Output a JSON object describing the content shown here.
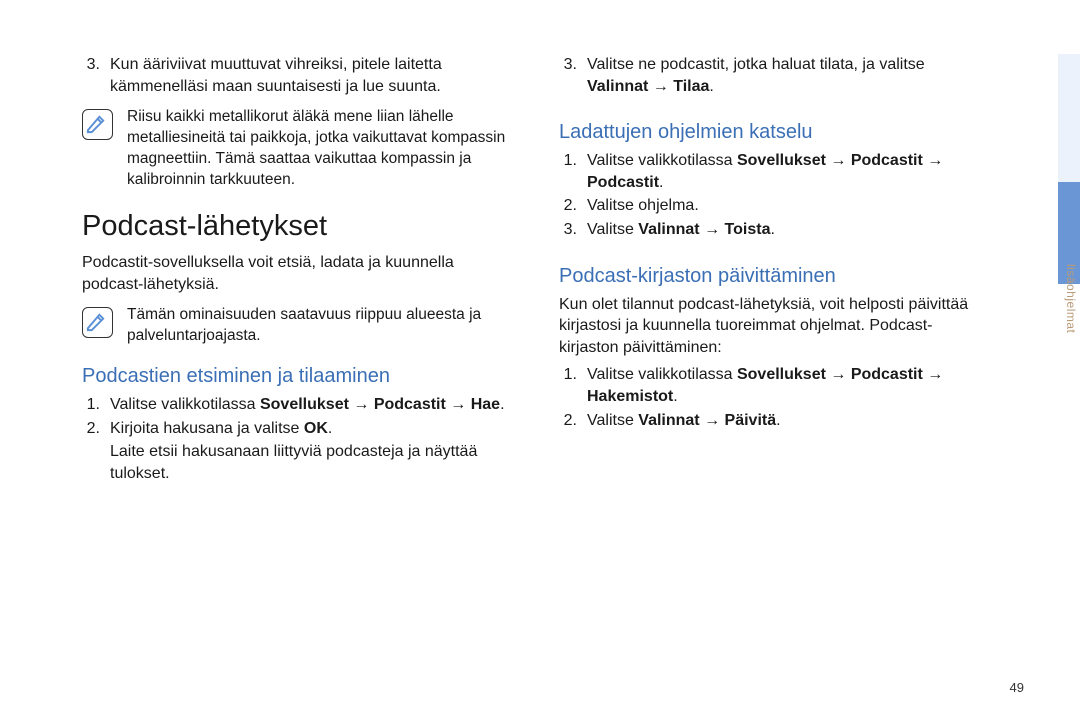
{
  "side_tab_label": "lisäohjelmat",
  "page_number": "49",
  "left": {
    "item3_num": "3.",
    "item3_text": "Kun ääriviivat muuttuvat vihreiksi, pitele laitetta kämmenelläsi maan suuntaisesti ja lue suunta.",
    "note1": "Riisu kaikki metallikorut äläkä mene liian lähelle metalliesineitä tai paikkoja, jotka vaikuttavat kompassin magneettiin. Tämä saattaa vaikuttaa kompassin ja kalibroinnin tarkkuuteen.",
    "h1": "Podcast-lähetykset",
    "p1": "Podcastit-sovelluksella voit etsiä, ladata ja kuunnella podcast-lähetyksiä.",
    "note2": "Tämän ominaisuuden saatavuus riippuu alueesta ja palveluntarjoajasta.",
    "h2": "Podcastien etsiminen ja tilaaminen",
    "s1_num": "1.",
    "s1_a": "Valitse valikkotilassa ",
    "s1_b": "Sovellukset",
    "s1_c": " → ",
    "s1_d": "Podcastit",
    "s1_e": " → ",
    "s1_f": "Hae",
    "s1_g": ".",
    "s2_num": "2.",
    "s2_a": "Kirjoita hakusana ja valitse ",
    "s2_b": "OK",
    "s2_c": ".",
    "s2_cont": "Laite etsii hakusanaan liittyviä podcasteja ja näyttää tulokset."
  },
  "right": {
    "r3_num": "3.",
    "r3_a": "Valitse ne podcastit, jotka haluat tilata, ja valitse ",
    "r3_b": "Valinnat",
    "r3_c": " → ",
    "r3_d": "Tilaa",
    "r3_e": ".",
    "h2a": "Ladattujen ohjelmien katselu",
    "a1_num": "1.",
    "a1_a": "Valitse valikkotilassa ",
    "a1_b": "Sovellukset",
    "a1_c": " → ",
    "a1_d": "Podcastit",
    "a1_e": " → ",
    "a1_f": "Podcastit",
    "a1_g": ".",
    "a2_num": "2.",
    "a2_a": "Valitse ohjelma.",
    "a3_num": "3.",
    "a3_a": "Valitse ",
    "a3_b": "Valinnat",
    "a3_c": " → ",
    "a3_d": "Toista",
    "a3_e": ".",
    "h2b": "Podcast-kirjaston päivittäminen",
    "pb": "Kun olet tilannut podcast-lähetyksiä, voit helposti päivittää kirjastosi ja kuunnella tuoreimmat ohjelmat. Podcast-kirjaston päivittäminen:",
    "b1_num": "1.",
    "b1_a": "Valitse valikkotilassa ",
    "b1_b": "Sovellukset",
    "b1_c": " → ",
    "b1_d": "Podcastit",
    "b1_e": " → ",
    "b1_f": "Hakemistot",
    "b1_g": ".",
    "b2_num": "2.",
    "b2_a": "Valitse ",
    "b2_b": "Valinnat",
    "b2_c": " → ",
    "b2_d": "Päivitä",
    "b2_e": "."
  }
}
